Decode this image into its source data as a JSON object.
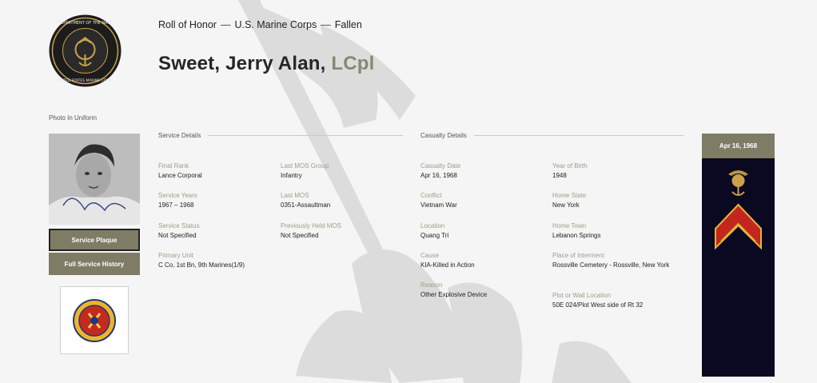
{
  "header": {
    "breadcrumb": [
      "Roll of Honor",
      "U.S. Marine Corps",
      "Fallen"
    ],
    "breadcrumb_sep": "—",
    "name": "Sweet, Jerry Alan,",
    "rank": "LCpl"
  },
  "seal": {
    "icon": "department-of-the-navy-seal-icon",
    "text": "DEPARTMENT OF THE NAVY · UNITED STATES MARINE CORPS"
  },
  "left": {
    "photo_label": "Photo In Uniform",
    "service_plaque_label": "Service Plaque",
    "full_history_label": "Full Service History",
    "patch_icon": "unit-patch-icon"
  },
  "service": {
    "heading": "Service Details",
    "fields": [
      {
        "label": "Final Rank",
        "value": "Lance Corporal"
      },
      {
        "label": "Service Years",
        "value": "1967 – 1968"
      },
      {
        "label": "Service Status",
        "value": "Not Specified"
      },
      {
        "label": "Primary Unit",
        "value": "C Co, 1st Bn, 9th Marines(1/9)"
      },
      {
        "label": "Last MOS Group",
        "value": "Infantry"
      },
      {
        "label": "Last MOS",
        "value": "0351-Assaultman"
      },
      {
        "label": "Previously Held MOS",
        "value": "Not Specified"
      }
    ]
  },
  "casualty": {
    "heading": "Casualty Details",
    "fields": [
      {
        "label": "Casualty Date",
        "value": "Apr 16, 1968"
      },
      {
        "label": "Conflict",
        "value": "Vietnam War"
      },
      {
        "label": "Location",
        "value": "Quang Tri"
      },
      {
        "label": "Cause",
        "value": "KIA-Killed in Action"
      },
      {
        "label": "Reason",
        "value": "Other Explosive Device"
      },
      {
        "label": "Year of Birth",
        "value": "1948"
      },
      {
        "label": "Home State",
        "value": "New York"
      },
      {
        "label": "Home Town",
        "value": "Lebanon Springs"
      },
      {
        "label": "Place of Interment",
        "value": "Rossville Cemetery - Rossville, New York"
      },
      {
        "label": "Plot or Wall Location",
        "value": "50E 024/Plot West side of Rt 32"
      }
    ]
  },
  "ribbon": {
    "date": "Apr 16, 1968",
    "emblem_icon": "eagle-globe-anchor-icon",
    "chevron_icon": "lance-corporal-chevron-icon",
    "background_color": "#0b0822",
    "chevron_color": "#c3261f",
    "accent_color": "#7f7c66"
  }
}
